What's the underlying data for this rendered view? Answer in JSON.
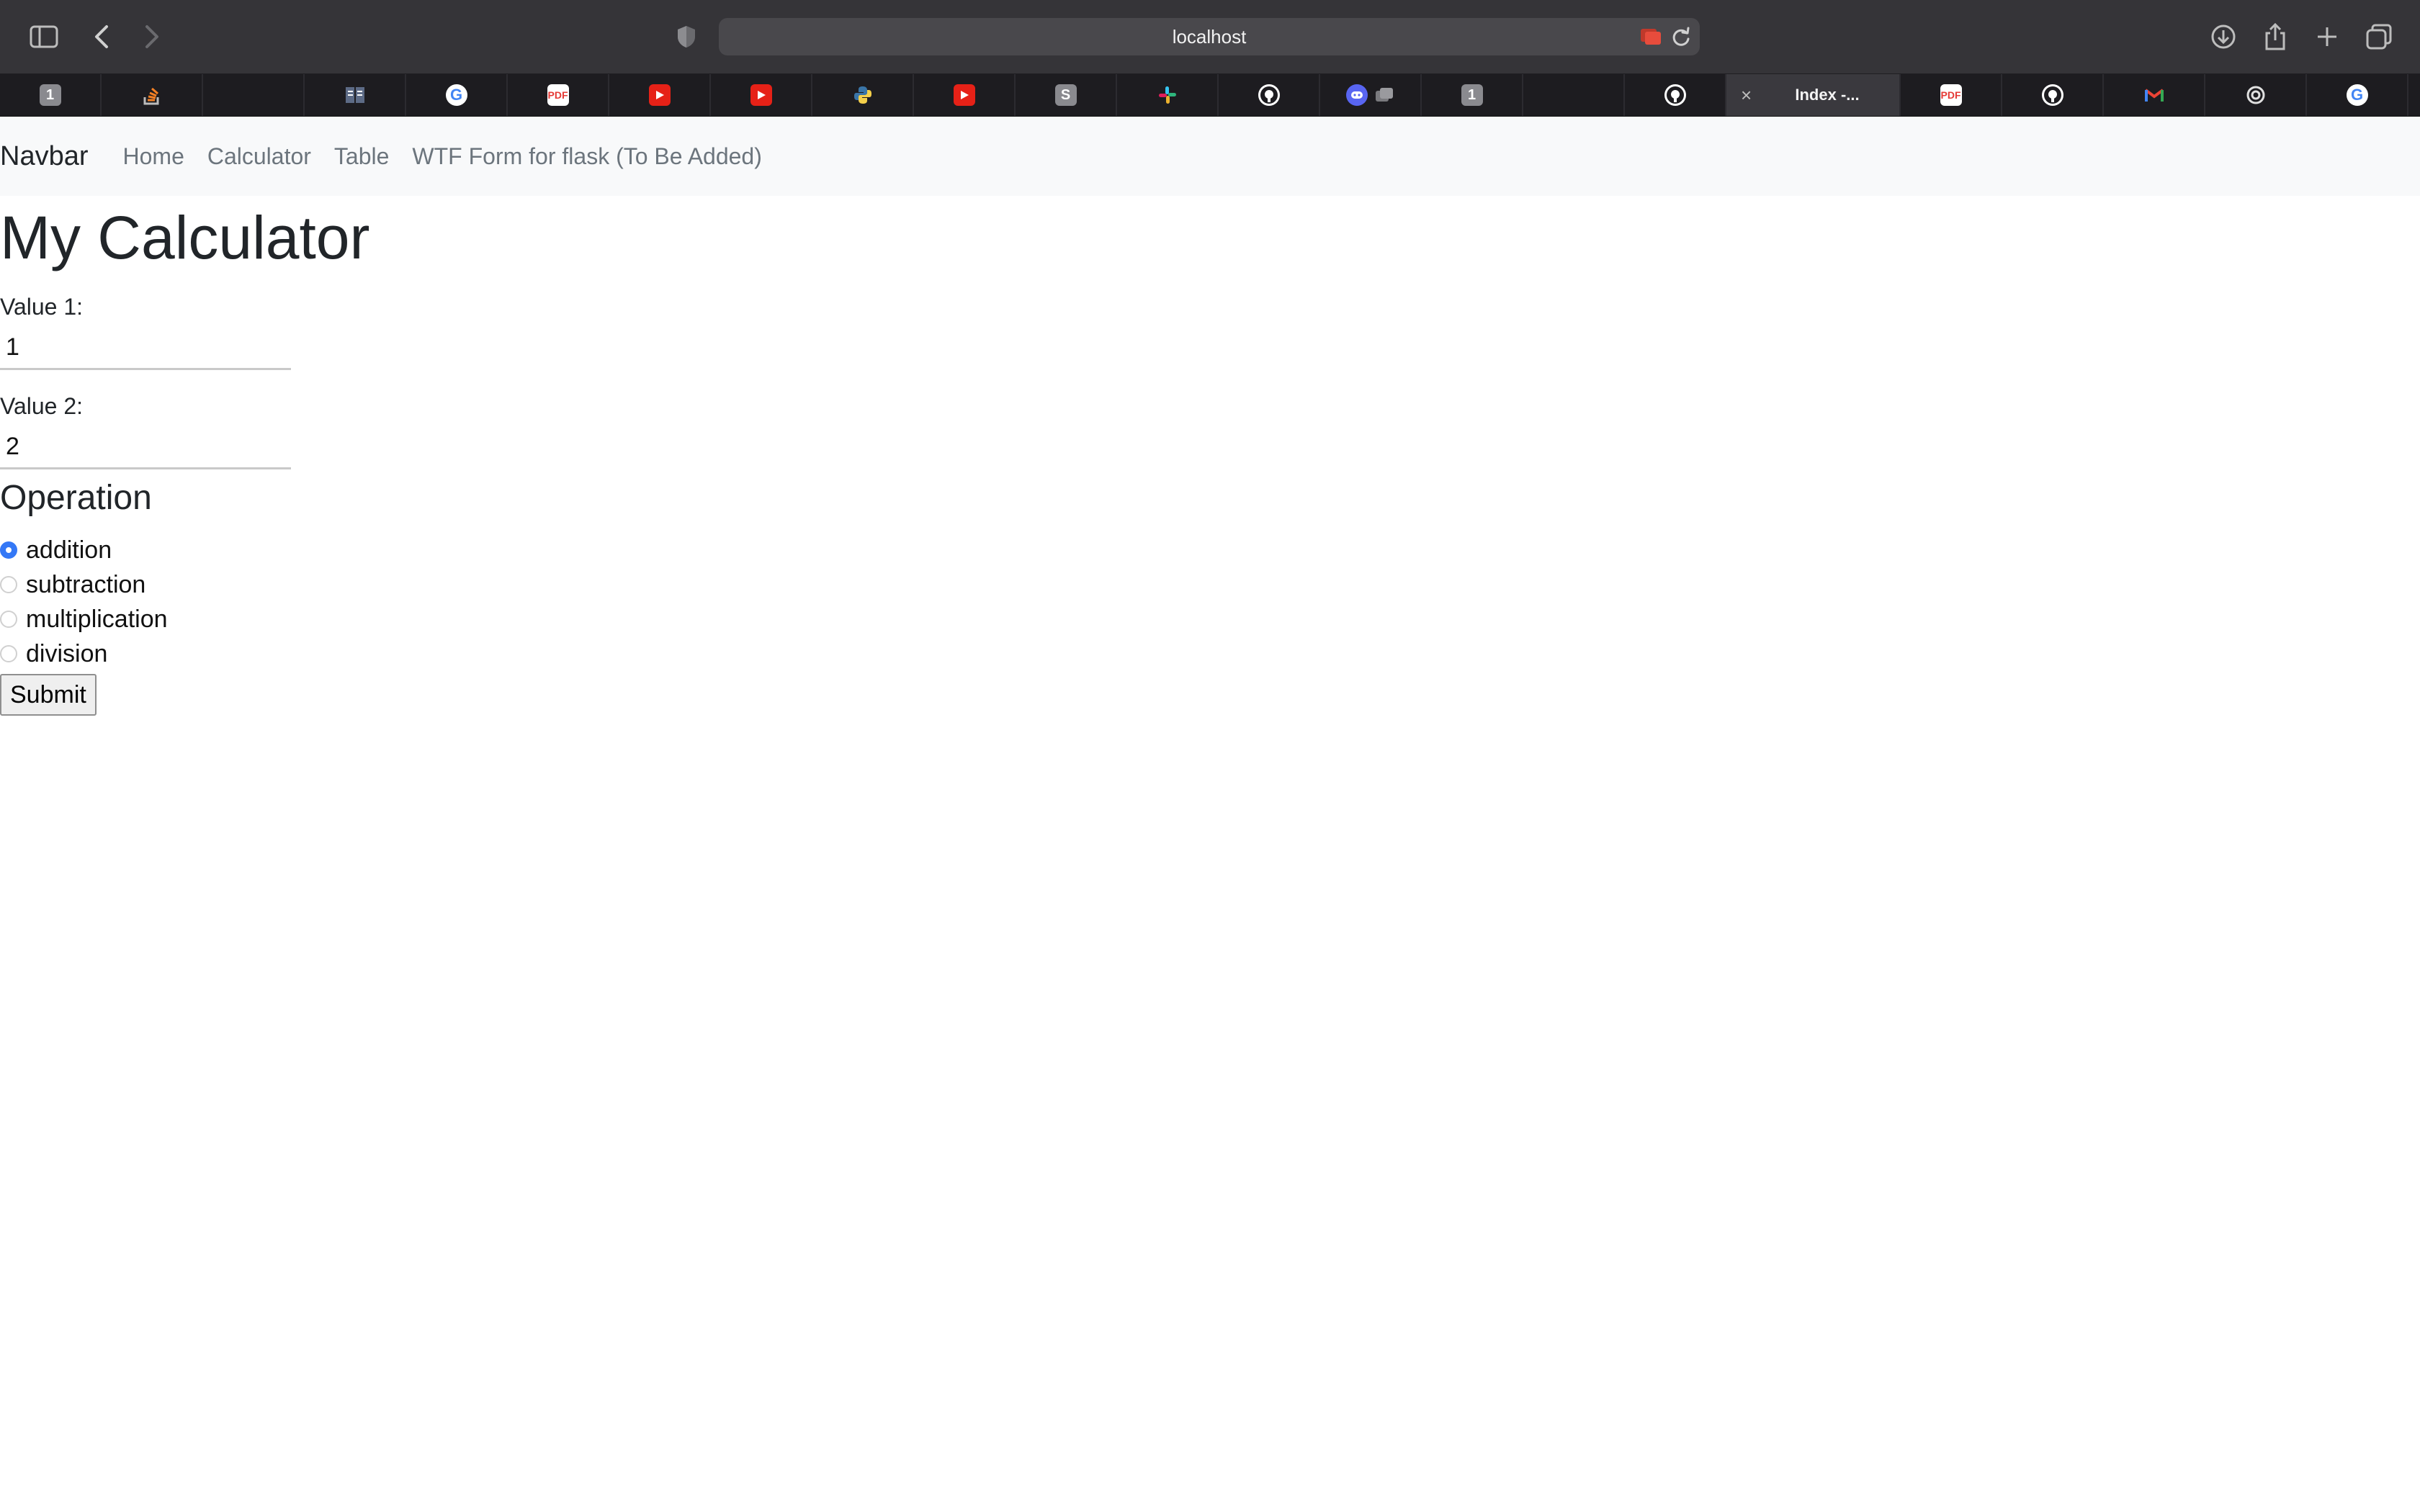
{
  "browser": {
    "url": "localhost",
    "active_tab_title": "Index -...",
    "tab_icons": [
      "1",
      "stack-overflow",
      "",
      "reader",
      "G",
      "pdf",
      "youtube",
      "youtube",
      "python",
      "youtube",
      "S",
      "slack",
      "github",
      "discord",
      "1",
      "",
      "github",
      "active",
      "pdf",
      "github",
      "gmail",
      "openai",
      "G"
    ]
  },
  "navbar": {
    "brand": "Navbar",
    "links": [
      "Home",
      "Calculator",
      "Table",
      "WTF Form for flask (To Be Added)"
    ]
  },
  "page": {
    "title": "My Calculator",
    "value1_label": "Value 1:",
    "value1": "1",
    "value2_label": "Value 2:",
    "value2": "2",
    "operation_heading": "Operation",
    "operations": [
      "addition",
      "subtraction",
      "multiplication",
      "division"
    ],
    "selected_operation": "addition",
    "submit_label": "Submit"
  },
  "colors": {
    "radio_accent": "#3478f6",
    "navbar_bg": "#f8f9fa",
    "toolbar_bg": "#353438"
  }
}
